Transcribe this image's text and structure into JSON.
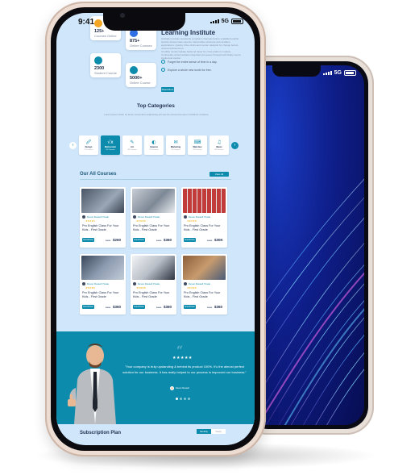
{
  "status": {
    "time": "9:41",
    "network": "5G"
  },
  "stats": [
    {
      "value": "125+",
      "label": "Courses Online",
      "color": "#f5a623"
    },
    {
      "value": "875+",
      "label": "Online Courses",
      "color": "#2f6fe4"
    },
    {
      "value": "2300",
      "label": "Student Course",
      "color": "#0c8bac"
    },
    {
      "value": "5000+",
      "label": "Online Course",
      "color": "#0c8bac"
    }
  ],
  "learning": {
    "title": "Learning Institute",
    "para1": "Globally incubate standards compliant channels before scalable benefits. Quickly disseminate superior deliverables whereas web-enabled applications. Quickly drive clicks-and-mortar catalysts for change before vertical architectures.",
    "para2": "Credibly reintermediate backend ideas for cross-platform models. Continually reintermediate integrated processes through technically sound intellectual capital.",
    "checks": [
      "Forget the entire sense of time in a day.",
      "Explore a whole new world for free."
    ],
    "button": "Read More"
  },
  "categories": {
    "title": "Top Categories",
    "subtitle": "Lorem ipsum dolor sit amet consectetur adipiscing elit sed do eiusmod tempor incididunt ut labore",
    "items": [
      {
        "icon": "🖉",
        "label": "Design",
        "count": "12 Courses"
      },
      {
        "icon": "√x",
        "label": "Mathematic",
        "count": "16 Courses",
        "active": true
      },
      {
        "icon": "✎",
        "label": "Art",
        "count": "09 Courses"
      },
      {
        "icon": "◐",
        "label": "Science",
        "count": "21 Courses"
      },
      {
        "icon": "✉",
        "label": "Marketing",
        "count": "15 Courses"
      },
      {
        "icon": "⌨",
        "label": "Web Dev",
        "count": "18 Courses"
      },
      {
        "icon": "♫",
        "label": "Music",
        "count": "08 Courses"
      }
    ]
  },
  "courses": {
    "title": "Our All Courses",
    "view_all": "View All",
    "items": [
      {
        "author": "Devon Russell Ytrade",
        "title": "Pro English Class For Your Kids - First Grade",
        "old": "$400",
        "price": "$260",
        "img": "#5d6b7c"
      },
      {
        "author": "Devon Russell Ytrade",
        "title": "Pro English Class For Your Kids - First Grade",
        "old": "$400",
        "price": "$360",
        "img": "#8a95a3"
      },
      {
        "author": "Devon Russell Ytrade",
        "title": "Pro English Class For Your Kids - First Grade",
        "old": "$400",
        "price": "$30K",
        "img": "#b33a3a"
      },
      {
        "author": "Devon Russell Ytrade",
        "title": "Pro English Class For Your Kids - First Grade",
        "old": "$400",
        "price": "$360",
        "img": "#6f7f96"
      },
      {
        "author": "Devon Russell Ytrade",
        "title": "Pro English Class For Your Kids - First Grade",
        "old": "$400",
        "price": "$360",
        "img": "#e3e6ea"
      },
      {
        "author": "Devon Russell Ytrade",
        "title": "Pro English Class For Your Kids - First Grade",
        "old": "$400",
        "price": "$360",
        "img": "#a4784f"
      }
    ]
  },
  "testimonial": {
    "stars": "★★★★★",
    "quote": "\"Your company is truly upstanding & behind its product 100%. It's the almost perfect solution for our business. It has really helped to our process in improved our business.\"",
    "author": "Devon Russell"
  },
  "subscription": {
    "title": "Subscription Plan",
    "monthly": "Monthly",
    "yearly": "Yearly"
  },
  "colors": {
    "accent": "#0c8bac",
    "page_bg": "#cfe6fb",
    "back_screen": "#0f1f8c"
  }
}
